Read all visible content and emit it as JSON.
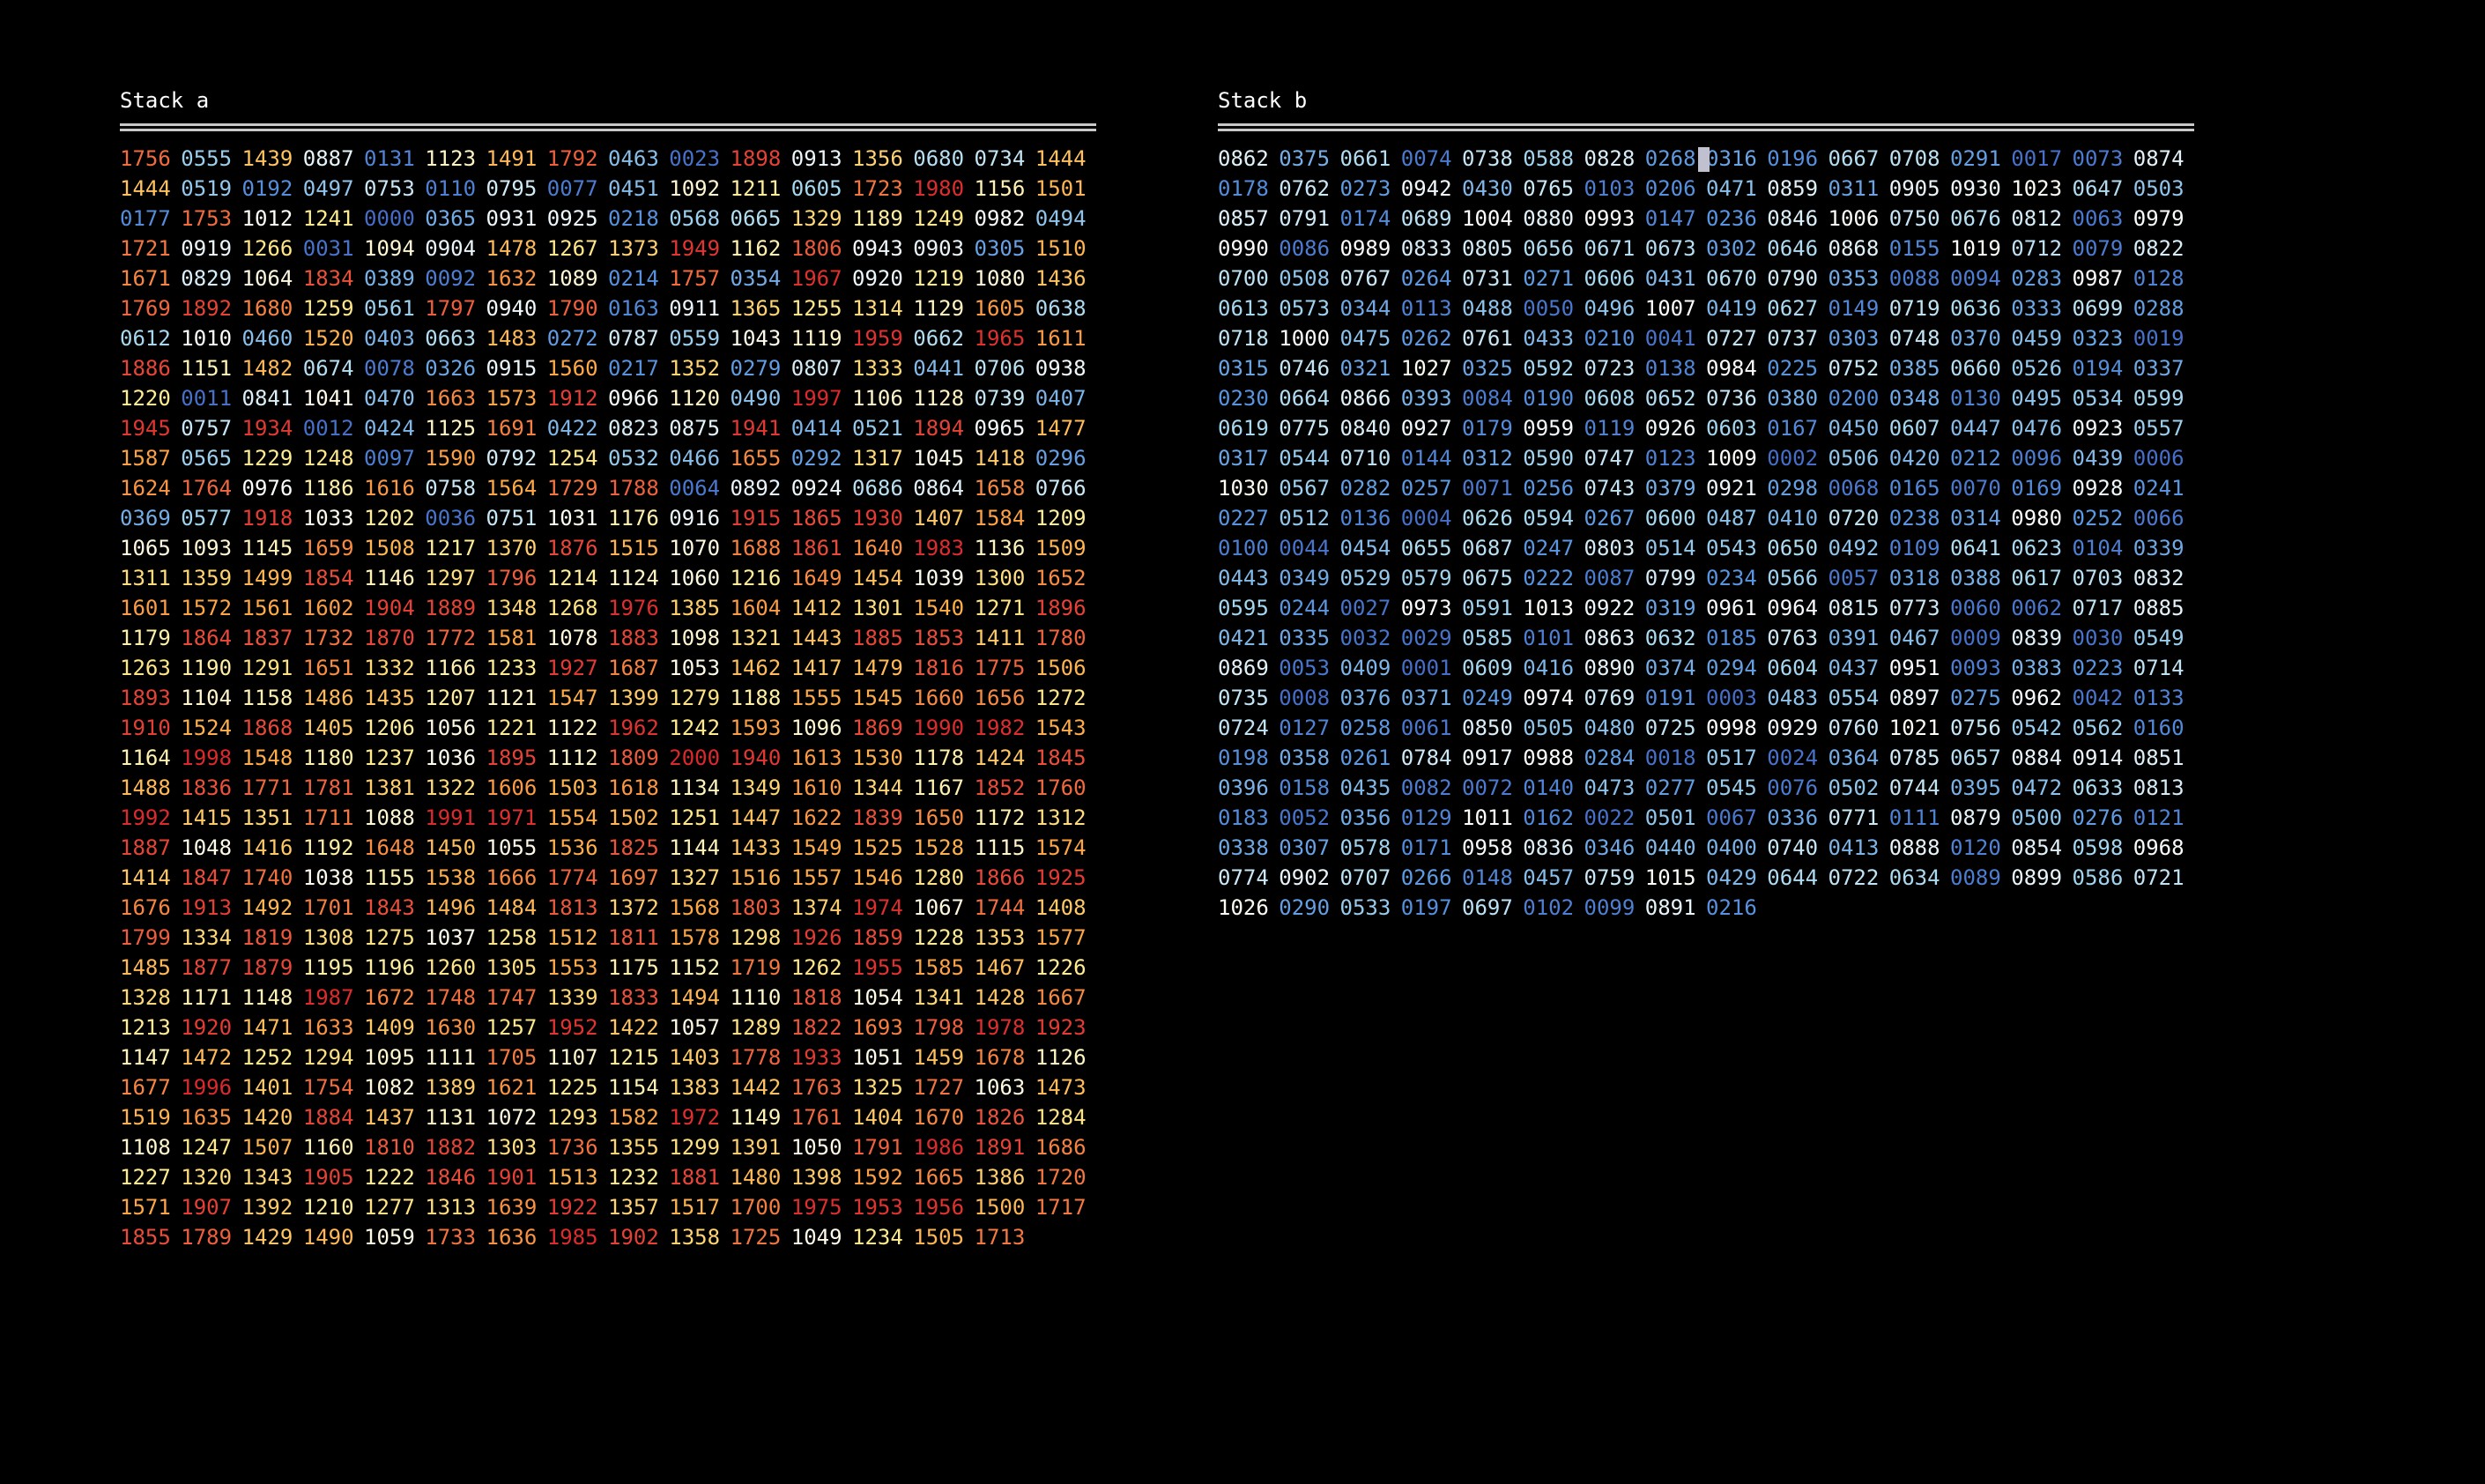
{
  "stack_a": {
    "title": "Stack a",
    "values": [
      "1756",
      "0555",
      "1439",
      "0887",
      "0131",
      "1123",
      "1491",
      "1792",
      "0463",
      "0023",
      "1898",
      "0913",
      "1356",
      "0680",
      "0734",
      "1444",
      "1444",
      "0519",
      "0192",
      "0497",
      "0753",
      "0110",
      "0795",
      "0077",
      "0451",
      "1092",
      "1211",
      "0605",
      "1723",
      "1980",
      "1156",
      "1501",
      "0177",
      "1753",
      "1012",
      "1241",
      "0000",
      "0365",
      "0931",
      "0925",
      "0218",
      "0568",
      "0665",
      "1329",
      "1189",
      "1249",
      "0982",
      "0494",
      "1721",
      "0919",
      "1266",
      "0031",
      "1094",
      "0904",
      "1478",
      "1267",
      "1373",
      "1949",
      "1162",
      "1806",
      "0943",
      "0903",
      "0305",
      "1510",
      "1671",
      "0829",
      "1064",
      "1834",
      "0389",
      "0092",
      "1632",
      "1089",
      "0214",
      "1757",
      "0354",
      "1967",
      "0920",
      "1219",
      "1080",
      "1436",
      "1769",
      "1892",
      "1680",
      "1259",
      "0561",
      "1797",
      "0940",
      "1790",
      "0163",
      "0911",
      "1365",
      "1255",
      "1314",
      "1129",
      "1605",
      "0638",
      "0612",
      "1010",
      "0460",
      "1520",
      "0403",
      "0663",
      "1483",
      "0272",
      "0787",
      "0559",
      "1043",
      "1119",
      "1959",
      "0662",
      "1965",
      "1611",
      "1886",
      "1151",
      "1482",
      "0674",
      "0078",
      "0326",
      "0915",
      "1560",
      "0217",
      "1352",
      "0279",
      "0807",
      "1333",
      "0441",
      "0706",
      "0938",
      "1220",
      "0011",
      "0841",
      "1041",
      "0470",
      "1663",
      "1573",
      "1912",
      "0966",
      "1120",
      "0490",
      "1997",
      "1106",
      "1128",
      "0739",
      "0407",
      "1945",
      "0757",
      "1934",
      "0012",
      "0424",
      "1125",
      "1691",
      "0422",
      "0823",
      "0875",
      "1941",
      "0414",
      "0521",
      "1894",
      "0965",
      "1477",
      "1587",
      "0565",
      "1229",
      "1248",
      "0097",
      "1590",
      "0792",
      "1254",
      "0532",
      "0466",
      "1655",
      "0292",
      "1317",
      "1045",
      "1418",
      "0296",
      "1624",
      "1764",
      "0976",
      "1186",
      "1616",
      "0758",
      "1564",
      "1729",
      "1788",
      "0064",
      "0892",
      "0924",
      "0686",
      "0864",
      "1658",
      "0766",
      "0369",
      "0577",
      "1918",
      "1033",
      "1202",
      "0036",
      "0751",
      "1031",
      "1176",
      "0916",
      "1915",
      "1865",
      "1930",
      "1407",
      "1584",
      "1209",
      "1065",
      "1093",
      "1145",
      "1659",
      "1508",
      "1217",
      "1370",
      "1876",
      "1515",
      "1070",
      "1688",
      "1861",
      "1640",
      "1983",
      "1136",
      "1509",
      "1311",
      "1359",
      "1499",
      "1854",
      "1146",
      "1297",
      "1796",
      "1214",
      "1124",
      "1060",
      "1216",
      "1649",
      "1454",
      "1039",
      "1300",
      "1652",
      "1601",
      "1572",
      "1561",
      "1602",
      "1904",
      "1889",
      "1348",
      "1268",
      "1976",
      "1385",
      "1604",
      "1412",
      "1301",
      "1540",
      "1271",
      "1896",
      "1179",
      "1864",
      "1837",
      "1732",
      "1870",
      "1772",
      "1581",
      "1078",
      "1883",
      "1098",
      "1321",
      "1443",
      "1885",
      "1853",
      "1411",
      "1780",
      "1263",
      "1190",
      "1291",
      "1651",
      "1332",
      "1166",
      "1233",
      "1927",
      "1687",
      "1053",
      "1462",
      "1417",
      "1479",
      "1816",
      "1775",
      "1506",
      "1893",
      "1104",
      "1158",
      "1486",
      "1435",
      "1207",
      "1121",
      "1547",
      "1399",
      "1279",
      "1188",
      "1555",
      "1545",
      "1660",
      "1656",
      "1272",
      "1910",
      "1524",
      "1868",
      "1405",
      "1206",
      "1056",
      "1221",
      "1122",
      "1962",
      "1242",
      "1593",
      "1096",
      "1869",
      "1990",
      "1982",
      "1543",
      "1164",
      "1998",
      "1548",
      "1180",
      "1237",
      "1036",
      "1895",
      "1112",
      "1809",
      "2000",
      "1940",
      "1613",
      "1530",
      "1178",
      "1424",
      "1845",
      "1488",
      "1836",
      "1771",
      "1781",
      "1381",
      "1322",
      "1606",
      "1503",
      "1618",
      "1134",
      "1349",
      "1610",
      "1344",
      "1167",
      "1852",
      "1760",
      "1992",
      "1415",
      "1351",
      "1711",
      "1088",
      "1991",
      "1971",
      "1554",
      "1502",
      "1251",
      "1447",
      "1622",
      "1839",
      "1650",
      "1172",
      "1312",
      "1887",
      "1048",
      "1416",
      "1192",
      "1648",
      "1450",
      "1055",
      "1536",
      "1825",
      "1144",
      "1433",
      "1549",
      "1525",
      "1528",
      "1115",
      "1574",
      "1414",
      "1847",
      "1740",
      "1038",
      "1155",
      "1538",
      "1666",
      "1774",
      "1697",
      "1327",
      "1516",
      "1557",
      "1546",
      "1280",
      "1866",
      "1925",
      "1676",
      "1913",
      "1492",
      "1701",
      "1843",
      "1496",
      "1484",
      "1813",
      "1372",
      "1568",
      "1803",
      "1374",
      "1974",
      "1067",
      "1744",
      "1408",
      "1799",
      "1334",
      "1819",
      "1308",
      "1275",
      "1037",
      "1258",
      "1512",
      "1811",
      "1578",
      "1298",
      "1926",
      "1859",
      "1228",
      "1353",
      "1577",
      "1485",
      "1877",
      "1879",
      "1195",
      "1196",
      "1260",
      "1305",
      "1553",
      "1175",
      "1152",
      "1719",
      "1262",
      "1955",
      "1585",
      "1467",
      "1226",
      "1328",
      "1171",
      "1148",
      "1987",
      "1672",
      "1748",
      "1747",
      "1339",
      "1833",
      "1494",
      "1110",
      "1818",
      "1054",
      "1341",
      "1428",
      "1667",
      "1213",
      "1920",
      "1471",
      "1633",
      "1409",
      "1630",
      "1257",
      "1952",
      "1422",
      "1057",
      "1289",
      "1822",
      "1693",
      "1798",
      "1978",
      "1923",
      "1147",
      "1472",
      "1252",
      "1294",
      "1095",
      "1111",
      "1705",
      "1107",
      "1215",
      "1403",
      "1778",
      "1933",
      "1051",
      "1459",
      "1678",
      "1126",
      "1677",
      "1996",
      "1401",
      "1754",
      "1082",
      "1389",
      "1621",
      "1225",
      "1154",
      "1383",
      "1442",
      "1763",
      "1325",
      "1727",
      "1063",
      "1473",
      "1519",
      "1635",
      "1420",
      "1884",
      "1437",
      "1131",
      "1072",
      "1293",
      "1582",
      "1972",
      "1149",
      "1761",
      "1404",
      "1670",
      "1826",
      "1284",
      "1108",
      "1247",
      "1507",
      "1160",
      "1810",
      "1882",
      "1303",
      "1736",
      "1355",
      "1299",
      "1391",
      "1050",
      "1791",
      "1986",
      "1891",
      "1686",
      "1227",
      "1320",
      "1343",
      "1905",
      "1222",
      "1846",
      "1901",
      "1513",
      "1232",
      "1881",
      "1480",
      "1398",
      "1592",
      "1665",
      "1386",
      "1720",
      "1571",
      "1907",
      "1392",
      "1210",
      "1277",
      "1313",
      "1639",
      "1922",
      "1357",
      "1517",
      "1700",
      "1975",
      "1953",
      "1956",
      "1500",
      "1717",
      "1855",
      "1789",
      "1429",
      "1490",
      "1059",
      "1733",
      "1636",
      "1985",
      "1902",
      "1358",
      "1725",
      "1049",
      "1234",
      "1505",
      "1713"
    ]
  },
  "stack_b": {
    "title": "Stack b",
    "values": [
      "0862",
      "0375",
      "0661",
      "0074",
      "0738",
      "0588",
      "0828",
      "0268",
      "0316",
      "0196",
      "0667",
      "0708",
      "0291",
      "0017",
      "0073",
      "0874",
      "0178",
      "0762",
      "0273",
      "0942",
      "0430",
      "0765",
      "0103",
      "0206",
      "0471",
      "0859",
      "0311",
      "0905",
      "0930",
      "1023",
      "0647",
      "0503",
      "0857",
      "0791",
      "0174",
      "0689",
      "1004",
      "0880",
      "0993",
      "0147",
      "0236",
      "0846",
      "1006",
      "0750",
      "0676",
      "0812",
      "0063",
      "0979",
      "0990",
      "0086",
      "0989",
      "0833",
      "0805",
      "0656",
      "0671",
      "0673",
      "0302",
      "0646",
      "0868",
      "0155",
      "1019",
      "0712",
      "0079",
      "0822",
      "0700",
      "0508",
      "0767",
      "0264",
      "0731",
      "0271",
      "0606",
      "0431",
      "0670",
      "0790",
      "0353",
      "0088",
      "0094",
      "0283",
      "0987",
      "0128",
      "0613",
      "0573",
      "0344",
      "0113",
      "0488",
      "0050",
      "0496",
      "1007",
      "0419",
      "0627",
      "0149",
      "0719",
      "0636",
      "0333",
      "0699",
      "0288",
      "0718",
      "1000",
      "0475",
      "0262",
      "0761",
      "0433",
      "0210",
      "0041",
      "0727",
      "0737",
      "0303",
      "0748",
      "0370",
      "0459",
      "0323",
      "0019",
      "0315",
      "0746",
      "0321",
      "1027",
      "0325",
      "0592",
      "0723",
      "0138",
      "0984",
      "0225",
      "0752",
      "0385",
      "0660",
      "0526",
      "0194",
      "0337",
      "0230",
      "0664",
      "0866",
      "0393",
      "0084",
      "0190",
      "0608",
      "0652",
      "0736",
      "0380",
      "0200",
      "0348",
      "0130",
      "0495",
      "0534",
      "0599",
      "0619",
      "0775",
      "0840",
      "0927",
      "0179",
      "0959",
      "0119",
      "0926",
      "0603",
      "0167",
      "0450",
      "0607",
      "0447",
      "0476",
      "0923",
      "0557",
      "0317",
      "0544",
      "0710",
      "0144",
      "0312",
      "0590",
      "0747",
      "0123",
      "1009",
      "0002",
      "0506",
      "0420",
      "0212",
      "0096",
      "0439",
      "0006",
      "1030",
      "0567",
      "0282",
      "0257",
      "0071",
      "0256",
      "0743",
      "0379",
      "0921",
      "0298",
      "0068",
      "0165",
      "0070",
      "0169",
      "0928",
      "0241",
      "0227",
      "0512",
      "0136",
      "0004",
      "0626",
      "0594",
      "0267",
      "0600",
      "0487",
      "0410",
      "0720",
      "0238",
      "0314",
      "0980",
      "0252",
      "0066",
      "0100",
      "0044",
      "0454",
      "0655",
      "0687",
      "0247",
      "0803",
      "0514",
      "0543",
      "0650",
      "0492",
      "0109",
      "0641",
      "0623",
      "0104",
      "0339",
      "0443",
      "0349",
      "0529",
      "0579",
      "0675",
      "0222",
      "0087",
      "0799",
      "0234",
      "0566",
      "0057",
      "0318",
      "0388",
      "0617",
      "0703",
      "0832",
      "0595",
      "0244",
      "0027",
      "0973",
      "0591",
      "1013",
      "0922",
      "0319",
      "0961",
      "0964",
      "0815",
      "0773",
      "0060",
      "0062",
      "0717",
      "0885",
      "0421",
      "0335",
      "0032",
      "0029",
      "0585",
      "0101",
      "0863",
      "0632",
      "0185",
      "0763",
      "0391",
      "0467",
      "0009",
      "0839",
      "0030",
      "0549",
      "0869",
      "0053",
      "0409",
      "0001",
      "0609",
      "0416",
      "0890",
      "0374",
      "0294",
      "0604",
      "0437",
      "0951",
      "0093",
      "0383",
      "0223",
      "0714",
      "0735",
      "0008",
      "0376",
      "0371",
      "0249",
      "0974",
      "0769",
      "0191",
      "0003",
      "0483",
      "0554",
      "0897",
      "0275",
      "0962",
      "0042",
      "0133",
      "0724",
      "0127",
      "0258",
      "0061",
      "0850",
      "0505",
      "0480",
      "0725",
      "0998",
      "0929",
      "0760",
      "1021",
      "0756",
      "0542",
      "0562",
      "0160",
      "0198",
      "0358",
      "0261",
      "0784",
      "0917",
      "0988",
      "0284",
      "0018",
      "0517",
      "0024",
      "0364",
      "0785",
      "0657",
      "0884",
      "0914",
      "0851",
      "0396",
      "0158",
      "0435",
      "0082",
      "0072",
      "0140",
      "0473",
      "0277",
      "0545",
      "0076",
      "0502",
      "0744",
      "0395",
      "0472",
      "0633",
      "0813",
      "0183",
      "0052",
      "0356",
      "0129",
      "1011",
      "0162",
      "0022",
      "0501",
      "0067",
      "0336",
      "0771",
      "0111",
      "0879",
      "0500",
      "0276",
      "0121",
      "0338",
      "0307",
      "0578",
      "0171",
      "0958",
      "0836",
      "0346",
      "0440",
      "0400",
      "0740",
      "0413",
      "0888",
      "0120",
      "0854",
      "0598",
      "0968",
      "0774",
      "0902",
      "0707",
      "0266",
      "0148",
      "0457",
      "0759",
      "1015",
      "0429",
      "0644",
      "0722",
      "0634",
      "0089",
      "0899",
      "0586",
      "0721",
      "1026",
      "0290",
      "0533",
      "0197",
      "0697",
      "0102",
      "0099",
      "0891",
      "0216"
    ]
  },
  "colors": {
    "background": "#000000",
    "text": "#ffffff",
    "rule": "#c8c8c8",
    "cursor": "#c0c0d0"
  },
  "cursor_icon": "block-cursor-icon"
}
